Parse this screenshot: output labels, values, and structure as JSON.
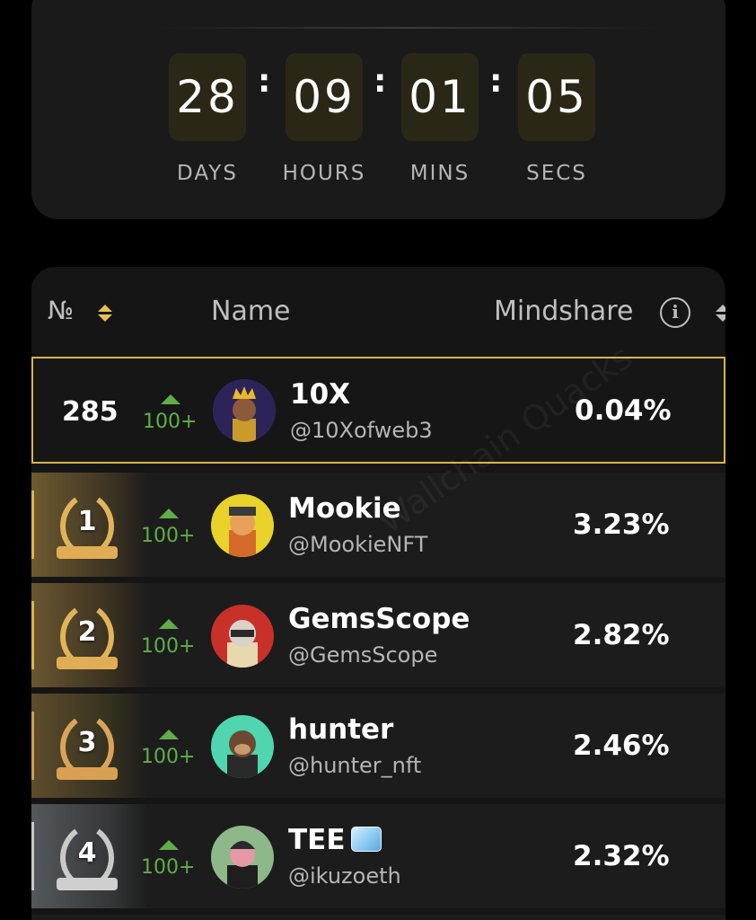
{
  "countdown": {
    "days": "28",
    "hours": "09",
    "mins": "01",
    "secs": "05",
    "days_label": "DAYS",
    "hours_label": "HOURS",
    "mins_label": "MINS",
    "secs_label": "SECS",
    "separator": ":"
  },
  "table": {
    "headers": {
      "rank": "№",
      "name": "Name",
      "mindshare": "Mindshare"
    },
    "current_user": {
      "rank": "285",
      "change": "100+",
      "name": "10X",
      "handle": "@10Xofweb3",
      "mindshare": "0.04%"
    },
    "rows": [
      {
        "rank": "1",
        "change": "100+",
        "name": "Mookie",
        "handle": "@MookieNFT",
        "mindshare": "3.23%"
      },
      {
        "rank": "2",
        "change": "100+",
        "name": "GemsScope",
        "handle": "@GemsScope",
        "mindshare": "2.82%"
      },
      {
        "rank": "3",
        "change": "100+",
        "name": "hunter",
        "handle": "@hunter_nft",
        "mindshare": "2.46%"
      },
      {
        "rank": "4",
        "change": "100+",
        "name": "TEE",
        "handle": "@ikuzoeth",
        "mindshare": "2.32%"
      }
    ]
  },
  "watermark": "Wallchain Quacks",
  "colors": {
    "accent_gold": "#d9b54a",
    "trend_green": "#5fae4a",
    "card_bg": "#1a1a1a"
  }
}
